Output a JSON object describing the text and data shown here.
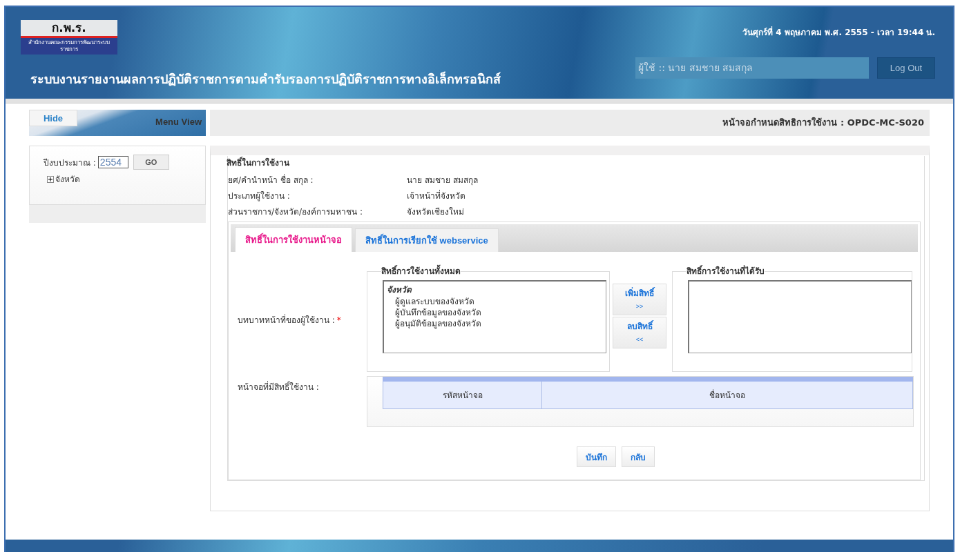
{
  "header": {
    "logo_text": "ก.พ.ร.",
    "logo_subtitle": "สำนักงานคณะกรรมการพัฒนาระบบราชการ",
    "title": "ระบบงานรายงานผลการปฏิบัติราชการตามคำรับรองการปฏิบัติราชการทางอิเล็กทรอนิกส์",
    "datetime": "วันศุกร์ที่ 4 พฤษภาคม พ.ศ. 2555 - เวลา 19:44 น.",
    "user_field": "ผู้ใช้ :: นาย สมชาย สมสกุล",
    "logout": "Log Out"
  },
  "sidebar": {
    "hide_button": "Hide",
    "menu_view": "Menu View",
    "year_label": "ปีงบประมาณ :",
    "year_value": "2554",
    "go_button": "GO",
    "tree": [
      {
        "label": "จังหวัด",
        "expanded": false
      }
    ]
  },
  "page_header": "หน้าจอกำหนดสิทธิการใช้งาน : OPDC-MC-S020",
  "fieldset": {
    "legend": "สิทธิ์ในการใช้งาน",
    "info": [
      {
        "label": "ยศ/คำนำหน้า ชื่อ สกุล :",
        "value": "นาย สมชาย สมสกุล"
      },
      {
        "label": "ประเภทผู้ใช้งาน :",
        "value": "เจ้าหน้าที่จังหวัด"
      },
      {
        "label": "ส่วนราชการ/จังหวัด/องค์การมหาชน :",
        "value": "จังหวัดเชียงใหม่"
      }
    ]
  },
  "tabs": [
    {
      "label": "สิทธิ์ในการใช้งานหน้าจอ",
      "selected": true
    },
    {
      "label": "สิทธิ์ในการเรียกใช้ webservice",
      "selected": false
    }
  ],
  "role_label": "บทบาทหน้าที่ของผู้ใช้งาน :",
  "required_mark": "*",
  "available": {
    "legend": "สิทธิ์การใช้งานทั้งหมด",
    "groups": [
      {
        "label": "จังหวัด",
        "children": [
          {
            "label": "ผู้ดูแลระบบของจังหวัด"
          },
          {
            "label": "ผู้บันทึกข้อมูลของจังหวัด"
          },
          {
            "label": "ผู้อนุมัติข้อมูลของจังหวัด"
          }
        ]
      }
    ]
  },
  "add_button": {
    "label": "เพิ่มสิทธิ์",
    "arrow": ">>"
  },
  "remove_button": {
    "label": "ลบสิทธิ์",
    "arrow": "<<"
  },
  "granted": {
    "legend": "สิทธิ์การใช้งานที่ได้รับ"
  },
  "screens_label": "หน้าจอที่มีสิทธิ์ใช้งาน :",
  "table": {
    "columns": [
      "รหัสหน้าจอ",
      "ชื่อหน้าจอ"
    ]
  },
  "buttons": [
    "บันทึก",
    "กลับ"
  ]
}
